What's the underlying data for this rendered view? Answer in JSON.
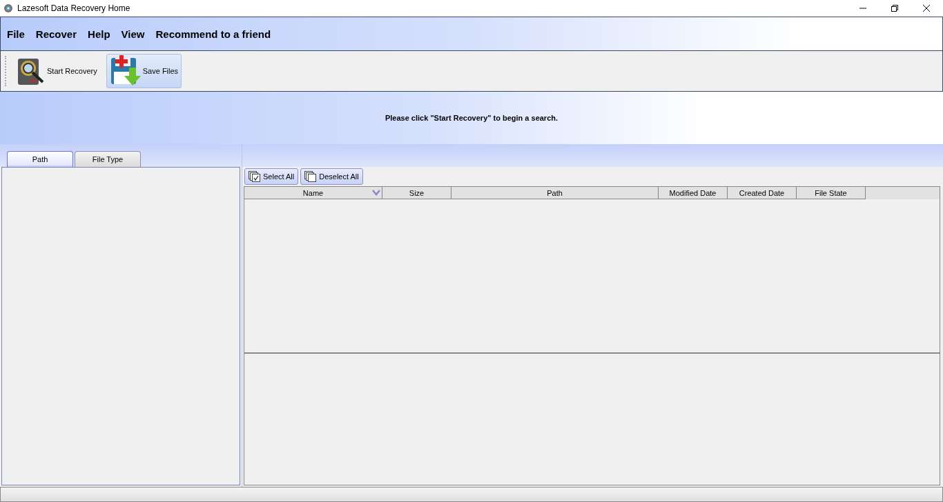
{
  "window": {
    "title": "Lazesoft Data Recovery Home"
  },
  "menu": [
    "File",
    "Recover",
    "Help",
    "View",
    "Recommend to a friend"
  ],
  "toolbar": [
    {
      "label": "Start Recovery",
      "kind": "recovery",
      "selected": false
    },
    {
      "label": "Save Files",
      "kind": "save",
      "selected": true
    }
  ],
  "banner": {
    "message": "Please click \"Start Recovery\" to begin a search."
  },
  "tabs": [
    {
      "label": "Path",
      "selected": true
    },
    {
      "label": "File Type",
      "selected": false
    }
  ],
  "actions": [
    {
      "label": "Select All",
      "kind": "select"
    },
    {
      "label": "Deselect All",
      "kind": "deselect"
    }
  ],
  "table": {
    "columns": [
      {
        "label": "Name",
        "sorted": true
      },
      {
        "label": "Size",
        "sorted": false
      },
      {
        "label": "Path",
        "sorted": false
      },
      {
        "label": "Modified Date",
        "sorted": false
      },
      {
        "label": "Created Date",
        "sorted": false
      },
      {
        "label": "File State",
        "sorted": false
      }
    ]
  }
}
